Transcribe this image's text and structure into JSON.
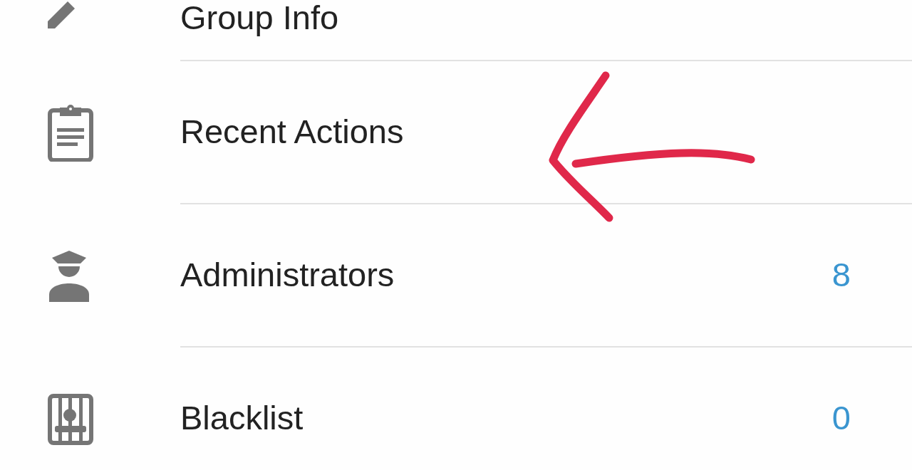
{
  "settings_list": [
    {
      "kind": "edit",
      "label": "Group Info"
    },
    {
      "kind": "log",
      "label": "Recent Actions"
    },
    {
      "kind": "admin",
      "label": "Administrators",
      "count": "8"
    },
    {
      "kind": "blocked",
      "label": "Blacklist",
      "count": "0"
    }
  ]
}
